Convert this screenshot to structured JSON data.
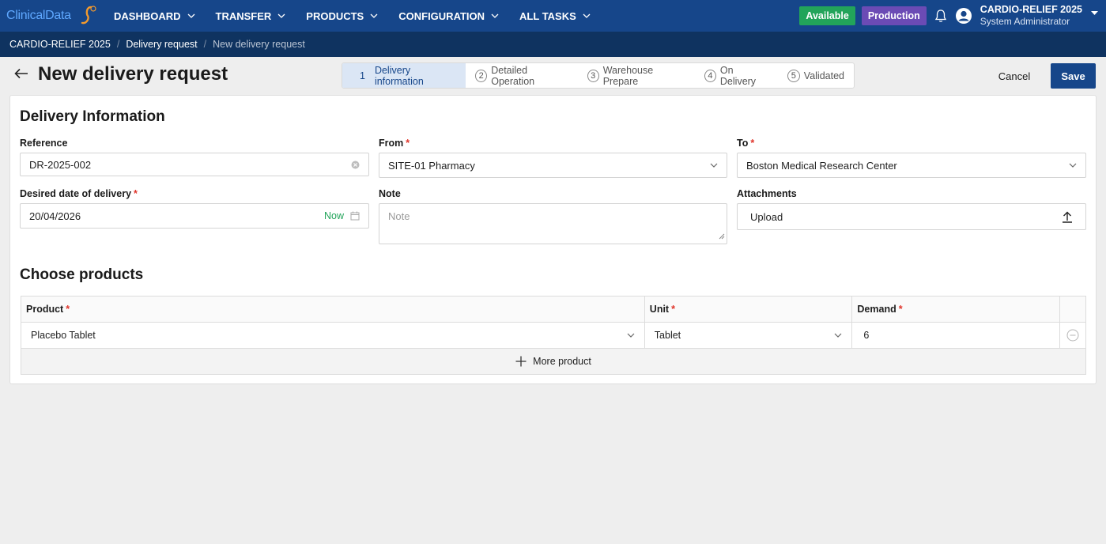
{
  "app": {
    "logo_text": "ClinicalData",
    "nav": [
      {
        "label": "DASHBOARD"
      },
      {
        "label": "TRANSFER"
      },
      {
        "label": "PRODUCTS"
      },
      {
        "label": "CONFIGURATION"
      },
      {
        "label": "ALL TASKS"
      }
    ],
    "status_badge": "Available",
    "env_badge": "Production",
    "study": "CARDIO-RELIEF 2025",
    "user_role": "System Administrator"
  },
  "breadcrumb": [
    "CARDIO-RELIEF 2025",
    "Delivery request",
    "New delivery request"
  ],
  "header": {
    "title": "New delivery request",
    "cancel_label": "Cancel",
    "save_label": "Save"
  },
  "steps": [
    {
      "num": "1",
      "label": "Delivery information",
      "active": true
    },
    {
      "num": "2",
      "label": "Detailed Operation",
      "active": false
    },
    {
      "num": "3",
      "label": "Warehouse Prepare",
      "active": false
    },
    {
      "num": "4",
      "label": "On Delivery",
      "active": false
    },
    {
      "num": "5",
      "label": "Validated",
      "active": false
    }
  ],
  "delivery_info": {
    "section_title": "Delivery Information",
    "reference": {
      "label": "Reference",
      "value": "DR-2025-002"
    },
    "from": {
      "label": "From",
      "value": "SITE-01 Pharmacy"
    },
    "to": {
      "label": "To",
      "value": "Boston Medical Research Center"
    },
    "desired_date": {
      "label": "Desired date of delivery",
      "value": "20/04/2026",
      "now_label": "Now"
    },
    "note": {
      "label": "Note",
      "placeholder": "Note"
    },
    "attachments": {
      "label": "Attachments",
      "upload_label": "Upload"
    }
  },
  "products": {
    "section_title": "Choose products",
    "columns": [
      "Product",
      "Unit",
      "Demand"
    ],
    "rows": [
      {
        "product": "Placebo Tablet",
        "unit": "Tablet",
        "demand": "6"
      }
    ],
    "more_label": "More product"
  },
  "colors": {
    "nav_bg": "#16468a",
    "breadcrumb_bg": "#0f3360",
    "available": "#22a45a",
    "production": "#6b4bb5",
    "required": "#e0352b"
  }
}
